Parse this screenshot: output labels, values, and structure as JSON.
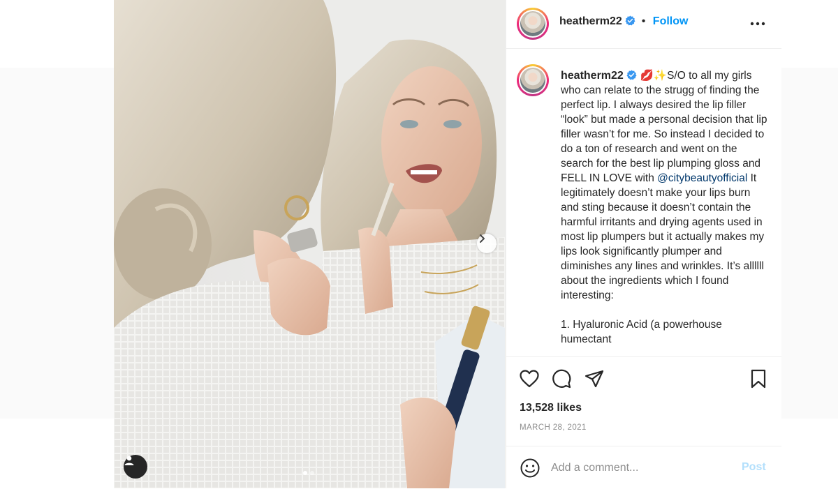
{
  "photo": {
    "alt_icon": "mirror-selfie-photo",
    "next_icon": "chevron-right-icon",
    "user_tag_icon": "user-icon",
    "carousel": {
      "count": 2,
      "active": 1
    }
  },
  "header": {
    "username": "heatherm22",
    "verified": true,
    "follow_label": "Follow",
    "bullet": "•",
    "more_icon": "more-options-icon"
  },
  "caption": {
    "username": "heatherm22",
    "emojis": "💋✨",
    "text_before_mention": "S/O to all my girls who can relate to the strugg of finding the perfect lip. I always desired the lip filler “look” but made a personal decision that lip filler wasn’t for me. So instead I decided to do a ton of research and went on the search for the best lip plumping gloss and FELL IN LOVE with ",
    "mention": "@citybeautyofficial",
    "text_after_mention": " It legitimately doesn’t make your lips burn and sting because it doesn’t contain the harmful irritants and drying agents used in most lip plumpers but it actually makes my lips look significantly plumper and diminishes any lines and wrinkles. It’s allllll about the ingredients which I found interesting:",
    "next_line": "1. Hyaluronic Acid (a powerhouse humectant"
  },
  "actions": {
    "like_icon": "heart-icon",
    "comment_icon": "comment-icon",
    "share_icon": "share-icon",
    "save_icon": "bookmark-icon",
    "likes": "13,528 likes",
    "date": "MARCH 28, 2021"
  },
  "comment": {
    "emoji_icon": "emoji-icon",
    "placeholder": "Add a comment...",
    "post_label": "Post"
  },
  "colors": {
    "link": "#0095f6",
    "mention": "#00376b",
    "muted": "#8e8e8e",
    "post_disabled": "#b2dffc",
    "verified": "#3897f0"
  }
}
